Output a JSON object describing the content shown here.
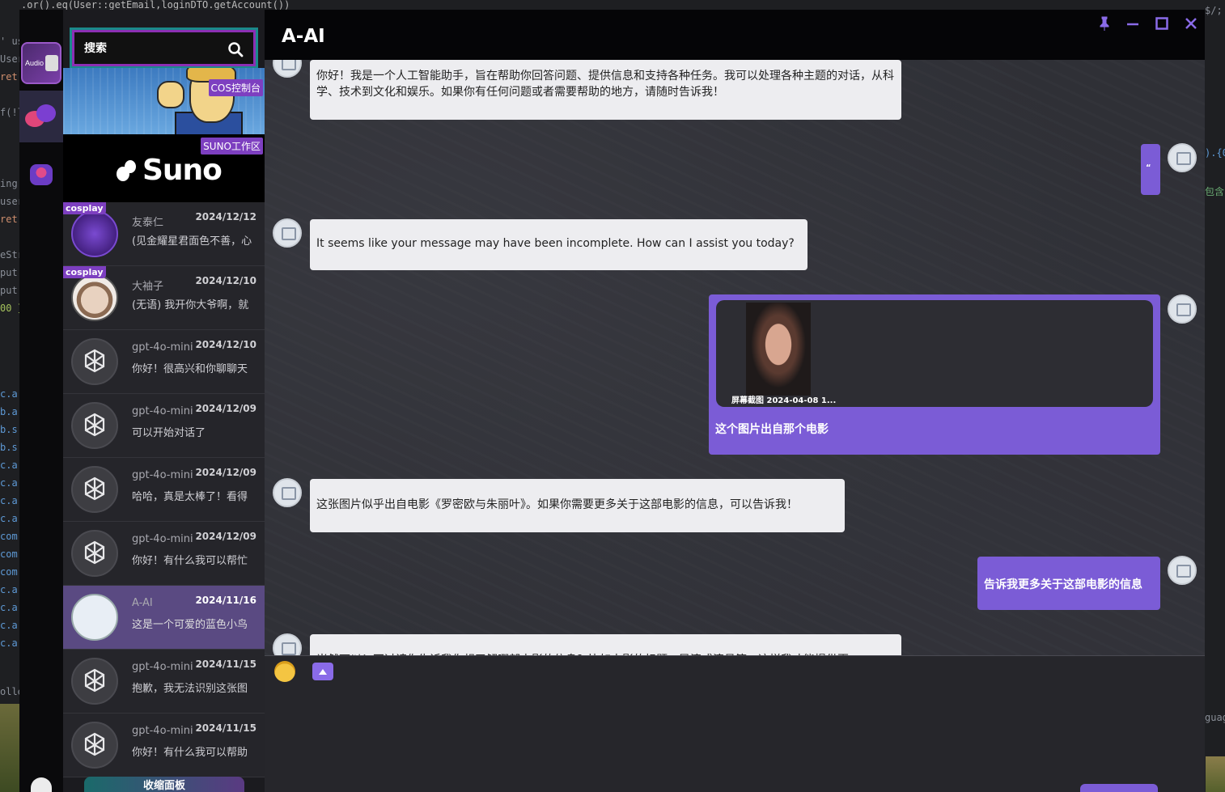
{
  "background": {
    "code_top": ".or().eq(User::getEmail,loginDTO.getAccount())",
    "left_gutter": [
      "' us",
      "User",
      "  ret",
      "f(!l",
      "  ",
      "ing",
      "user",
      "  ret",
      "eStr",
      " put",
      " put",
      " 00 }",
      "c.a",
      "b.a",
      "b.s",
      "b.s",
      "c.a",
      "c.a",
      "c.a",
      "c.a",
      "com",
      "com",
      "com",
      "c.a",
      "c.a",
      "c.a",
      "c.a",
      "olle"
    ],
    "right_gutter": [
      "$/;",
      ").{0",
      "包含",
      "guag"
    ]
  },
  "rail": {
    "audio_label": "Audio"
  },
  "sidebar": {
    "search_placeholder": "搜索",
    "banner_cos_label": "COS控制台",
    "banner_suno_label": "SUNO工作区",
    "suno_text": "Suno",
    "collapse_label": "收缩面板",
    "conversations": [
      {
        "tag": "cosplay",
        "name": "友泰仁",
        "date": "2024/12/12",
        "preview": "(见金耀星君面色不善，心",
        "avatar": "purple"
      },
      {
        "tag": "cosplay",
        "name": "大袖子",
        "date": "2024/12/10",
        "preview": "(无语) 我开你大爷啊，就",
        "avatar": "face"
      },
      {
        "tag": "",
        "name": "gpt-4o-mini",
        "date": "2024/12/10",
        "preview": "你好！很高兴和你聊聊天",
        "avatar": "gpt"
      },
      {
        "tag": "",
        "name": "gpt-4o-mini",
        "date": "2024/12/09",
        "preview": "可以开始对话了",
        "avatar": "gpt"
      },
      {
        "tag": "",
        "name": "gpt-4o-mini",
        "date": "2024/12/09",
        "preview": "哈哈，真是太棒了！看得",
        "avatar": "gpt"
      },
      {
        "tag": "",
        "name": "gpt-4o-mini",
        "date": "2024/12/09",
        "preview": "你好！有什么我可以帮忙",
        "avatar": "gpt"
      },
      {
        "tag": "",
        "name": "A-AI",
        "date": "2024/11/16",
        "preview": "这是一个可爱的蓝色小鸟",
        "avatar": "robot",
        "active": true
      },
      {
        "tag": "",
        "name": "gpt-4o-mini",
        "date": "2024/11/15",
        "preview": "抱歉，我无法识别这张图",
        "avatar": "gpt"
      },
      {
        "tag": "",
        "name": "gpt-4o-mini",
        "date": "2024/11/15",
        "preview": "你好！有什么我可以帮助",
        "avatar": "gpt"
      }
    ]
  },
  "chat": {
    "title": "A-AI",
    "messages": [
      {
        "role": "ai",
        "text": "你好！我是一个人工智能助手，旨在帮助你回答问题、提供信息和支持各种任务。我可以处理各种主题的对话，从科学、技术到文化和娱乐。如果你有任何问题或者需要帮助的地方，请随时告诉我！"
      },
      {
        "role": "user",
        "text": "“"
      },
      {
        "role": "ai",
        "text": "It seems like your message may have been incomplete. How can I assist you today?"
      },
      {
        "role": "user",
        "image_caption": "屏幕截图 2024-04-08 1...",
        "text": "这个图片出自那个电影"
      },
      {
        "role": "ai",
        "text": "这张图片似乎出自电影《罗密欧与朱丽叶》。如果你需要更多关于这部电影的信息，可以告诉我！"
      },
      {
        "role": "user",
        "text": "告诉我更多关于这部电影的信息"
      },
      {
        "role": "ai",
        "text": "当然可以！不过请你告诉我你想了解哪部电影的信息？比如电影的标题、导演或演员等，这样我才能提供更"
      }
    ]
  },
  "composer": {
    "emoji": "emoji-icon",
    "upload": "upload-icon"
  },
  "colors": {
    "accent": "#7b5cd6",
    "rail_bg": "#0a0a0c",
    "header_bg": "#050507",
    "tag_purple": "#7d3fc0"
  }
}
